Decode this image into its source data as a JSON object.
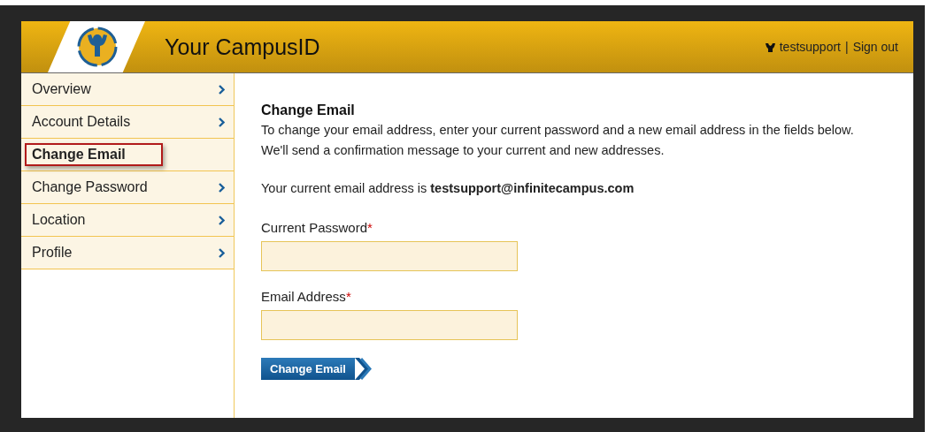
{
  "header": {
    "title": "Your CampusID",
    "username": "testsupport",
    "separator": "|",
    "sign_out": "Sign out"
  },
  "sidebar": {
    "items": [
      {
        "label": "Overview",
        "selected": false
      },
      {
        "label": "Account Details",
        "selected": false
      },
      {
        "label": "Change Email",
        "selected": true
      },
      {
        "label": "Change Password",
        "selected": false
      },
      {
        "label": "Location",
        "selected": false
      },
      {
        "label": "Profile",
        "selected": false
      }
    ]
  },
  "form": {
    "heading": "Change Email",
    "description": "To change your email address, enter your current password and a new email address in the fields below. We'll send a confirmation message to your current and new addresses.",
    "current_email": "Your current email address is **testsupport@infinitecampus.com**",
    "fields": [
      {
        "label": "Current Password",
        "required_mark": "*"
      },
      {
        "label": "Email Address",
        "required_mark": "*"
      }
    ],
    "submit": "Change Email"
  }
}
